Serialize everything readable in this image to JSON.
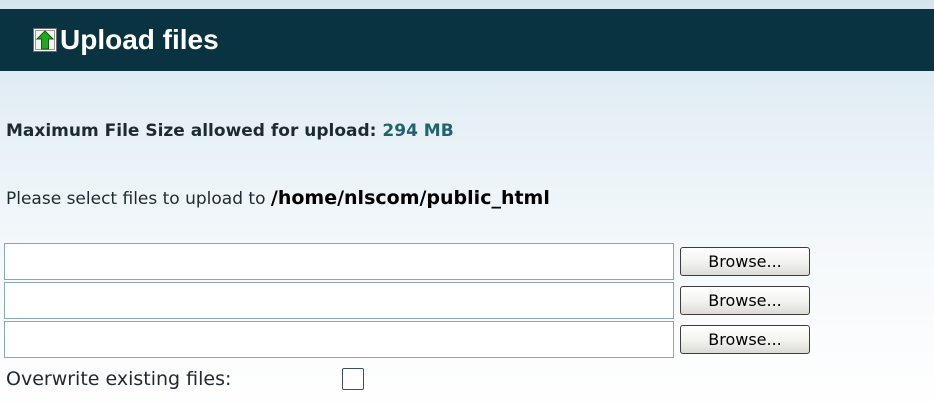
{
  "header": {
    "title": "Upload files",
    "icon": "upload-arrow-icon"
  },
  "info": {
    "max_size_label": "Maximum File Size allowed for upload:",
    "max_size_value": "294 MB",
    "select_prefix": "Please select files to upload to",
    "target_path": "/home/nlscom/public_html"
  },
  "file_inputs": [
    {
      "value": "",
      "browse_label": "Browse..."
    },
    {
      "value": "",
      "browse_label": "Browse..."
    },
    {
      "value": "",
      "browse_label": "Browse..."
    }
  ],
  "overwrite": {
    "label": "Overwrite existing files:",
    "checked": false
  },
  "colors": {
    "header_bg": "#0a3342",
    "size_value": "#20626f"
  }
}
